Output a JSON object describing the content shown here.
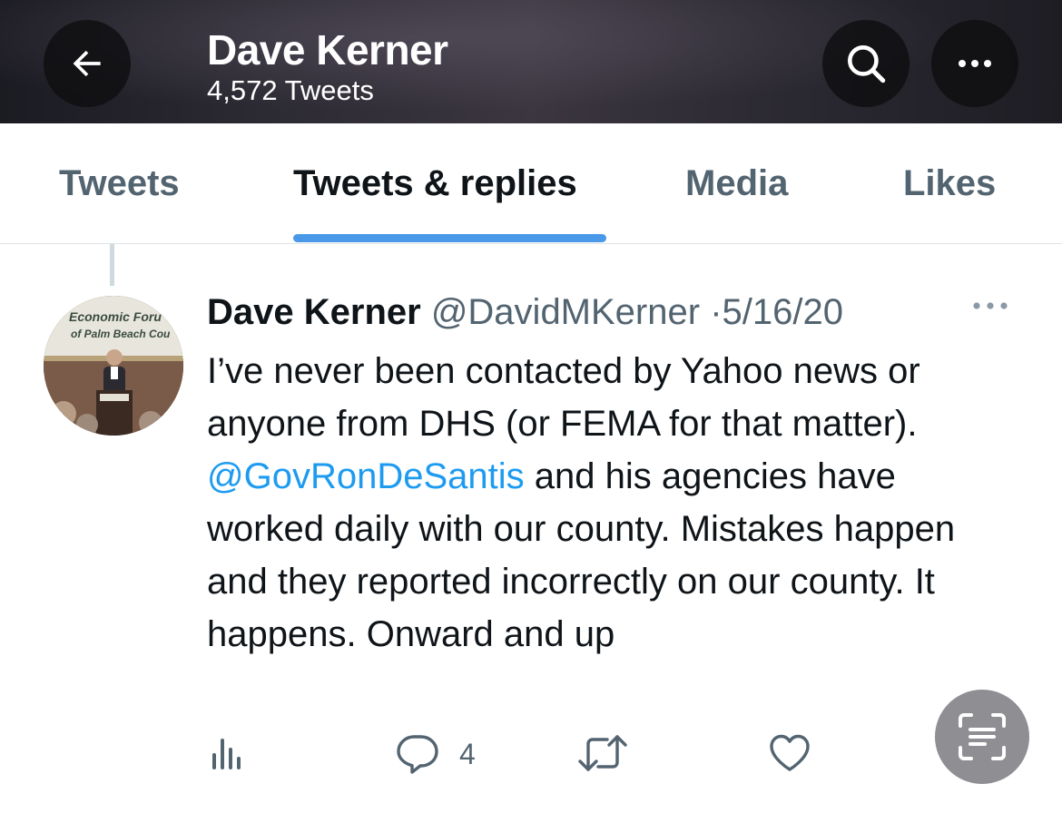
{
  "header": {
    "title": "Dave Kerner",
    "subtitle": "4,572 Tweets",
    "icons": {
      "back": "arrow-left-icon",
      "search": "search-icon",
      "more": "more-horizontal-icon"
    }
  },
  "tabs": [
    {
      "label": "Tweets",
      "active": false
    },
    {
      "label": "Tweets & replies",
      "active": true
    },
    {
      "label": "Media",
      "active": false
    },
    {
      "label": "Likes",
      "active": false
    }
  ],
  "tweet": {
    "name": "Dave Kerner",
    "handle": "@DavidMKerner",
    "separator": "·",
    "date": "5/16/20",
    "avatar_text": {
      "line1": "Economic Foru",
      "line2": "of Palm Beach Cou"
    },
    "text_before": "I’ve never been contacted by Yahoo news or anyone from DHS (or FEMA for that matter). ",
    "mention": "@GovRonDeSantis",
    "text_after": " and his agencies have worked daily with our county. Mistakes happen and they reported incorrectly on our county. It happens. Onward and up",
    "reply_count": "4"
  },
  "colors": {
    "accent": "#1d9bf0",
    "tab_indicator": "#4a99e9",
    "muted": "#536471",
    "text": "#0f1419"
  }
}
